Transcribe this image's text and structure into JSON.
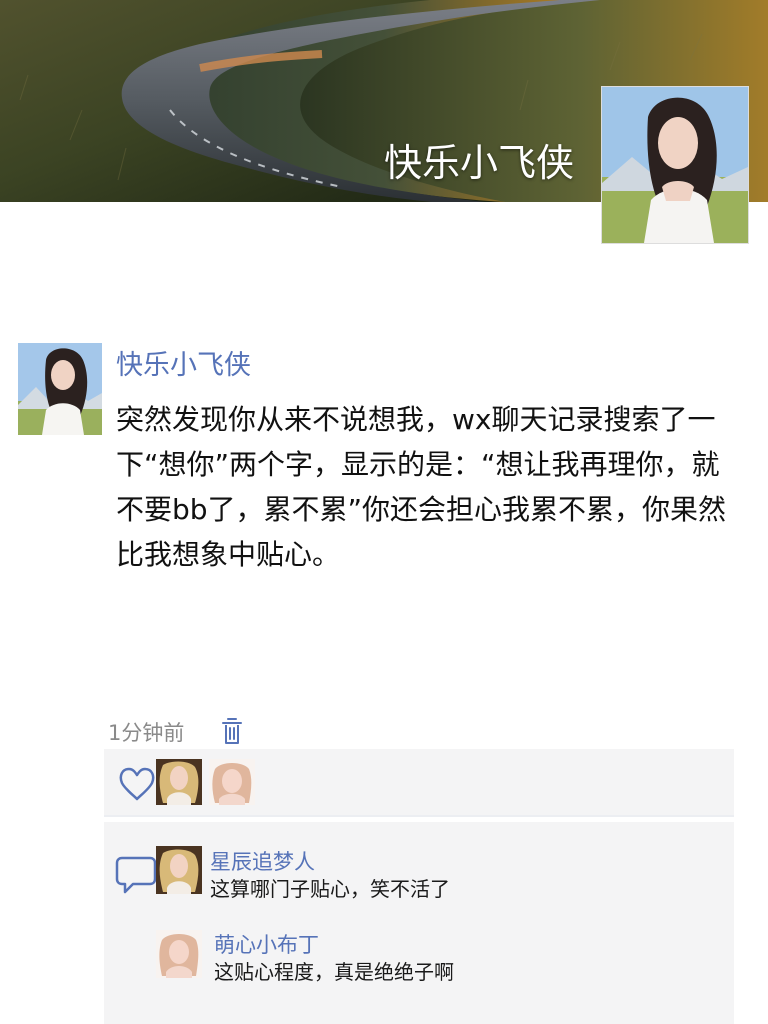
{
  "profile": {
    "name": "快乐小飞侠"
  },
  "post": {
    "author": "快乐小飞侠",
    "text": "突然发现你从来不说想我，wx聊天记录搜索了一下“想你”两个字，显示的是：“想让我再理你，就不要bb了，累不累”你还会担心我累不累，你果然比我想象中贴心。",
    "time": "1分钟前"
  },
  "likes": {
    "icon": "heart-icon",
    "users": [
      {
        "avatar": "blonde-avatar"
      },
      {
        "avatar": "light-hair-avatar"
      }
    ]
  },
  "comments": [
    {
      "author": "星辰追梦人",
      "text": "这算哪门子贴心，笑不活了",
      "avatar": "blonde-avatar"
    },
    {
      "author": "萌心小布丁",
      "text": "这贴心程度，真是绝绝子啊",
      "avatar": "light-hair-avatar"
    }
  ],
  "colors": {
    "link_blue": "#5673b8",
    "meta_gray": "#8a8a8a",
    "panel_bg": "#f4f4f5",
    "text_primary": "#111111"
  }
}
